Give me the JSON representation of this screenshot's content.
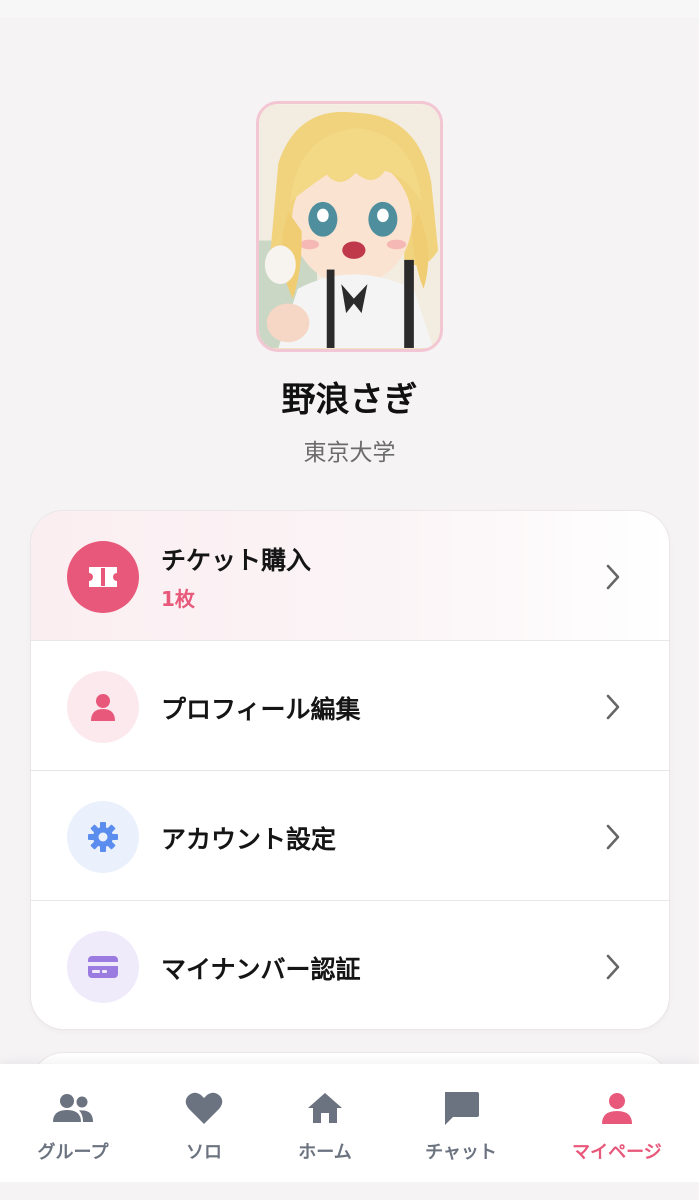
{
  "profile": {
    "name": "野浪さぎ",
    "school": "東京大学",
    "avatar_icon": "profile-photo"
  },
  "menu": {
    "items": [
      {
        "label": "チケット購入",
        "sub": "1枚",
        "icon": "ticket-icon",
        "color": "#e8587a"
      },
      {
        "label": "プロフィール編集",
        "icon": "person-icon",
        "color": "#e8587a"
      },
      {
        "label": "アカウント設定",
        "icon": "gear-icon",
        "color": "#5b8def"
      },
      {
        "label": "マイナンバー認証",
        "icon": "card-icon",
        "color": "#9b7be0"
      }
    ]
  },
  "bottom_nav": {
    "items": [
      {
        "label": "グループ",
        "icon": "group-icon"
      },
      {
        "label": "ソロ",
        "icon": "heart-icon"
      },
      {
        "label": "ホーム",
        "icon": "home-icon"
      },
      {
        "label": "チャット",
        "icon": "chat-icon"
      },
      {
        "label": "マイページ",
        "icon": "person-icon",
        "active": true
      }
    ],
    "active_color": "#e8587a",
    "inactive_color": "#6b7280"
  }
}
